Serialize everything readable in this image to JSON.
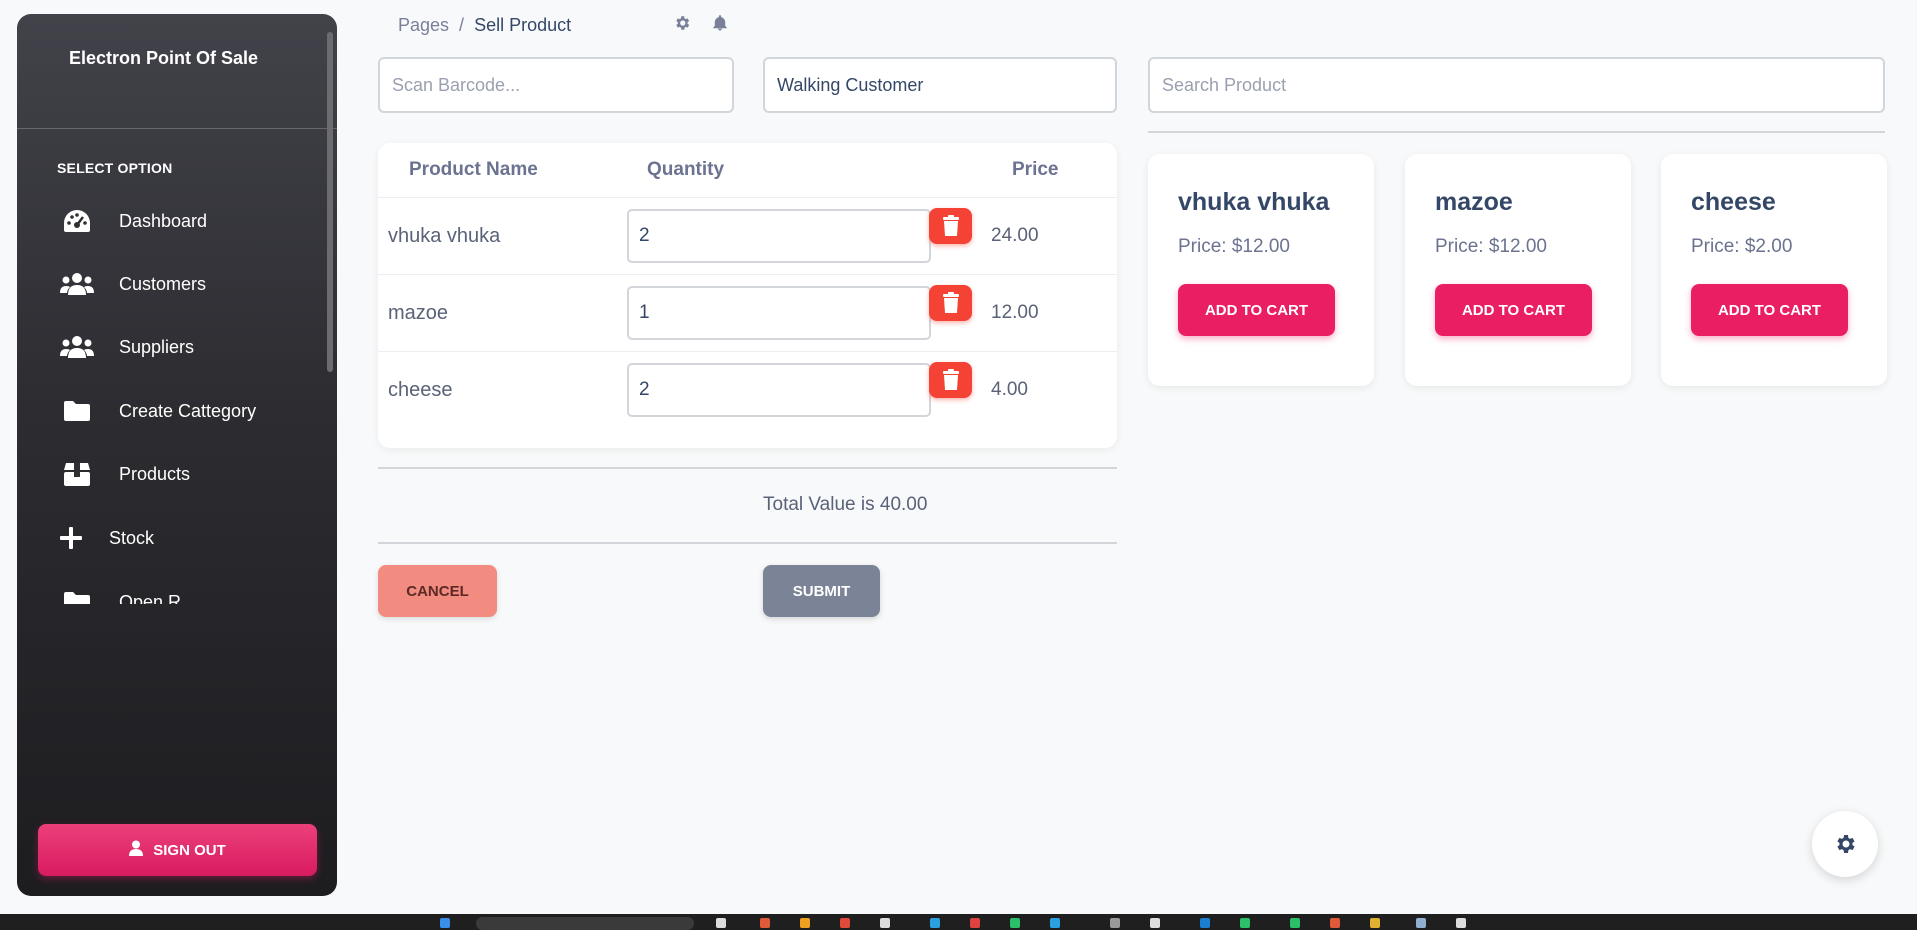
{
  "sidebar": {
    "brand": "Electron Point Of Sale",
    "section_label": "SELECT OPTION",
    "items": [
      {
        "label": "Dashboard",
        "icon": "dashboard-gauge-icon"
      },
      {
        "label": "Customers",
        "icon": "users-icon"
      },
      {
        "label": "Suppliers",
        "icon": "users-icon"
      },
      {
        "label": "Create Cattegory",
        "icon": "folder-icon"
      },
      {
        "label": "Products",
        "icon": "box-icon"
      },
      {
        "label": "Stock",
        "icon": "plus-icon"
      },
      {
        "label": "Open R...",
        "icon": "folder-icon"
      }
    ],
    "signout_label": "SIGN OUT"
  },
  "breadcrumb": {
    "root": "Pages",
    "separator": "/",
    "current": "Sell Product"
  },
  "inputs": {
    "barcode_placeholder": "Scan Barcode...",
    "customer_value": "Walking Customer",
    "search_placeholder": "Search Product"
  },
  "cart": {
    "headers": {
      "name": "Product Name",
      "quantity": "Quantity",
      "price": "Price"
    },
    "rows": [
      {
        "name": "vhuka vhuka",
        "quantity": "2",
        "price": "24.00"
      },
      {
        "name": "mazoe",
        "quantity": "1",
        "price": "12.00"
      },
      {
        "name": "cheese",
        "quantity": "2",
        "price": "4.00"
      }
    ],
    "total_text": "Total Value is 40.00",
    "cancel_label": "CANCEL",
    "submit_label": "SUBMIT"
  },
  "products": [
    {
      "name": "vhuka vhuka",
      "price": "Price: $12.00",
      "button": "ADD TO CART"
    },
    {
      "name": "mazoe",
      "price": "Price: $12.00",
      "button": "ADD TO CART"
    },
    {
      "name": "cheese",
      "price": "Price: $2.00",
      "button": "ADD TO CART"
    }
  ],
  "colors": {
    "accent": "#e91e63",
    "danger": "#f44335",
    "sidebar_top": "#42424a",
    "sidebar_bottom": "#1d1d20"
  }
}
